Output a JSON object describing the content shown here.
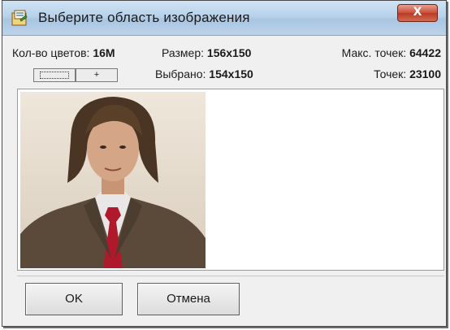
{
  "window": {
    "title": "Выберите область изображения",
    "close_label": "X",
    "icon": "app-icon"
  },
  "info": {
    "colors_label": "Кол-во цветов:",
    "colors_value": "16M",
    "size_label": "Размер:",
    "size_value": "156x150",
    "selected_label": "Выбрано:",
    "selected_value": "154x150",
    "max_points_label": "Макс. точек:",
    "max_points_value": "64422",
    "points_label": "Точек:",
    "points_value": "23100"
  },
  "tools": {
    "select_tool_icon": "dotted-rectangle-icon",
    "plus_label": "+"
  },
  "buttons": {
    "ok_label": "OK",
    "cancel_label": "Отмена"
  }
}
